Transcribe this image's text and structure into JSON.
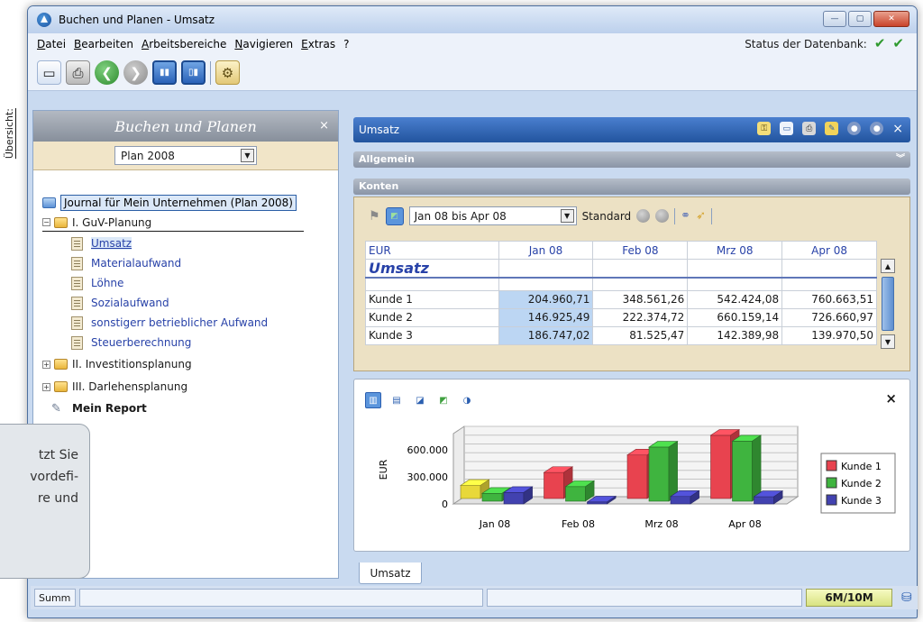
{
  "window": {
    "title": "Buchen und Planen - Umsatz",
    "controls": {
      "minimize": "—",
      "maximize": "▢",
      "close": "✕"
    }
  },
  "menu": {
    "items": [
      "Datei",
      "Bearbeiten",
      "Arbeitsbereiche",
      "Navigieren",
      "Extras",
      "?"
    ],
    "db_status_label": "Status der Datenbank:",
    "db_checks": [
      "✔",
      "✔"
    ]
  },
  "side_tab": {
    "label": "Übersicht:"
  },
  "left_panel": {
    "title": "Buchen und Planen",
    "close": "×",
    "plan_select": "Plan 2008",
    "tree": {
      "root": "Journal für Mein Unternehmen (Plan 2008)",
      "gv": "I. GuV-Planung",
      "gv_items": [
        "Umsatz",
        "Materialaufwand",
        "Löhne",
        "Sozialaufwand",
        "sonstigerr betrieblicher Aufwand",
        "Steuerberechnung"
      ],
      "invest": "II. Investitionsplanung",
      "darlehen": "III. Darlehensplanung",
      "report": "Mein Report"
    }
  },
  "tooltip": {
    "lines": [
      "tzt Sie",
      "vordefi-",
      "re und"
    ]
  },
  "content": {
    "header": "Umsatz",
    "header_close": "×",
    "allgemein": "Allgemein",
    "konten": "Konten",
    "period_select": "Jan 08 bis Apr 08",
    "standard": "Standard",
    "grid": {
      "currency": "EUR",
      "columns": [
        "Jan 08",
        "Feb 08",
        "Mrz 08",
        "Apr 08"
      ],
      "section_title": "Umsatz",
      "rows": [
        {
          "label": "Kunde 1",
          "values": [
            "204.960,71",
            "348.561,26",
            "542.424,08",
            "760.663,51"
          ]
        },
        {
          "label": "Kunde 2",
          "values": [
            "146.925,49",
            "222.374,72",
            "660.159,14",
            "726.660,97"
          ]
        },
        {
          "label": "Kunde 3",
          "values": [
            "186.747,02",
            "81.525,47",
            "142.389,98",
            "139.970,50"
          ]
        }
      ]
    },
    "chart_close": "×",
    "tab": "Umsatz"
  },
  "chart_data": {
    "type": "bar",
    "categories": [
      "Jan 08",
      "Feb 08",
      "Mrz 08",
      "Apr 08"
    ],
    "series": [
      {
        "name": "Kunde 1",
        "values": [
          204960.71,
          348561.26,
          542424.08,
          760663.51
        ],
        "color": "#e8434f"
      },
      {
        "name": "Kunde 2",
        "values": [
          146925.49,
          222374.72,
          660159.14,
          726660.97
        ],
        "color": "#3fb43f"
      },
      {
        "name": "Kunde 3",
        "values": [
          186747.02,
          81525.47,
          142389.98,
          139970.5
        ],
        "color": "#4242b0"
      }
    ],
    "first_bar_color": "#e8d83a",
    "ylabel": "EUR",
    "yticks": [
      "0",
      "300.000",
      "600.000"
    ],
    "ylim": [
      0,
      780000
    ],
    "legend": "right",
    "grid": true
  },
  "statusbar": {
    "left": "Summ",
    "memory": "6M/10M"
  }
}
